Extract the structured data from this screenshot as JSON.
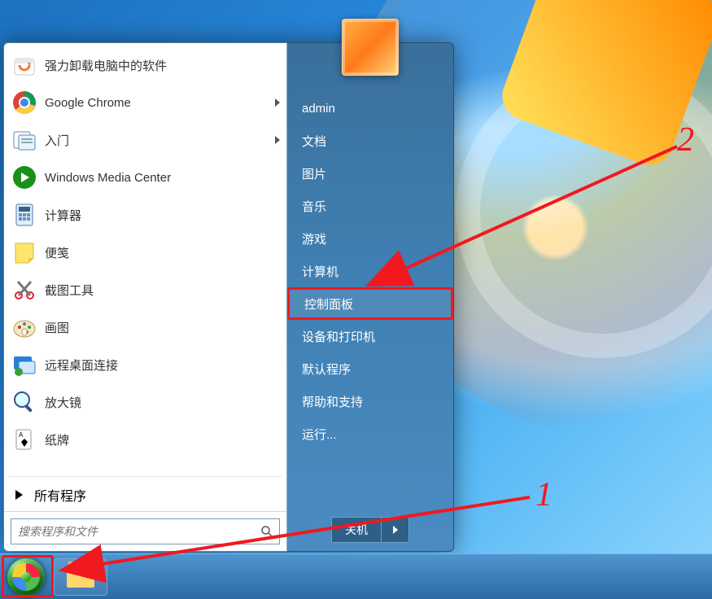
{
  "programs": [
    {
      "label": "强力卸载电脑中的软件",
      "arrow": false,
      "icon": "recycle"
    },
    {
      "label": "Google Chrome",
      "arrow": true,
      "icon": "chrome"
    },
    {
      "label": "入门",
      "arrow": true,
      "icon": "getstart"
    },
    {
      "label": "Windows Media Center",
      "arrow": false,
      "icon": "wmc"
    },
    {
      "label": "计算器",
      "arrow": false,
      "icon": "calc"
    },
    {
      "label": "便笺",
      "arrow": false,
      "icon": "sticky"
    },
    {
      "label": "截图工具",
      "arrow": false,
      "icon": "snip"
    },
    {
      "label": "画图",
      "arrow": false,
      "icon": "paint"
    },
    {
      "label": "远程桌面连接",
      "arrow": false,
      "icon": "rdp"
    },
    {
      "label": "放大镜",
      "arrow": false,
      "icon": "mag"
    },
    {
      "label": "纸牌",
      "arrow": false,
      "icon": "sol"
    }
  ],
  "all_programs": "所有程序",
  "search_placeholder": "搜索程序和文件",
  "right_items": [
    "admin",
    "文档",
    "图片",
    "音乐",
    "游戏",
    "计算机",
    "控制面板",
    "设备和打印机",
    "默认程序",
    "帮助和支持",
    "运行..."
  ],
  "control_panel_index": 6,
  "shutdown": "关机",
  "annotations": {
    "one": "1",
    "two": "2"
  }
}
